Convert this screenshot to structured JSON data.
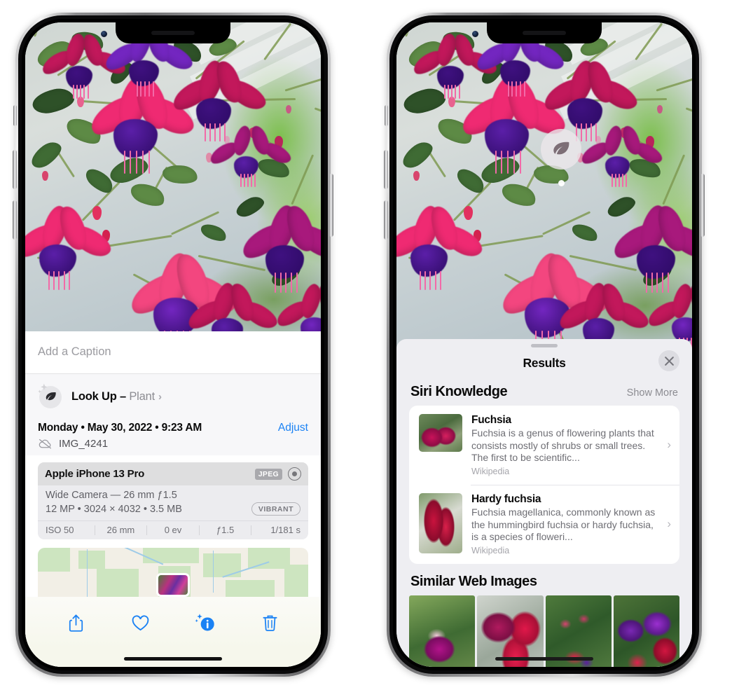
{
  "left_phone": {
    "caption": {
      "placeholder": "Add a Caption",
      "value": ""
    },
    "lookup": {
      "label": "Look Up – ",
      "subject": "Plant",
      "chevron": "›",
      "icon": "leaf-icon",
      "sparkle_icon": "sparkle-icon"
    },
    "info": {
      "date": "Monday • May 30, 2022 • 9:23 AM",
      "adjust_label": "Adjust",
      "filename": "IMG_4241",
      "cloud_icon": "cloud-slash-icon"
    },
    "camera_card": {
      "device": "Apple iPhone 13 Pro",
      "format_badge": "JPEG",
      "aperture_icon": "aperture-icon",
      "lens_line": "Wide Camera — 26 mm ƒ1.5",
      "specs_line": "12 MP • 3024 × 4032 • 3.5 MB",
      "style_badge": "VIBRANT",
      "exif": [
        "ISO 50",
        "26 mm",
        "0 ev",
        "ƒ1.5",
        "1/181 s"
      ]
    },
    "toolbar": [
      {
        "name": "share-button",
        "icon": "share-icon"
      },
      {
        "name": "favorite-button",
        "icon": "heart-icon"
      },
      {
        "name": "info-button",
        "icon": "info-sparkle-icon"
      },
      {
        "name": "delete-button",
        "icon": "trash-icon"
      }
    ],
    "map": {
      "pin_icon": "photo-pin"
    }
  },
  "right_phone": {
    "badge": {
      "icon": "leaf-icon"
    },
    "sheet": {
      "title": "Results",
      "close_label": "✕",
      "grabber": ""
    },
    "siri_knowledge": {
      "heading": "Siri Knowledge",
      "show_more": "Show More",
      "items": [
        {
          "title": "Fuchsia",
          "description": "Fuchsia is a genus of flowering plants that consists mostly of shrubs or small trees. The first to be scientific...",
          "source": "Wikipedia",
          "chevron": "›",
          "thumb": "fuchsia-red-thumb"
        },
        {
          "title": "Hardy fuchsia",
          "description": "Fuchsia magellanica, commonly known as the hummingbird fuchsia or hardy fuchsia, is a species of floweri...",
          "source": "Wikipedia",
          "chevron": "›",
          "thumb": "hardy-fuchsia-thumb"
        }
      ]
    },
    "similar_web_images": {
      "heading": "Similar Web Images",
      "items": [
        "web-image-1",
        "web-image-2",
        "web-image-3",
        "web-image-4"
      ]
    }
  },
  "colors": {
    "accent_blue": "#1b82f4",
    "sheet_gray": "#eeeef2",
    "card_gray": "#ececef",
    "text_secondary": "#6e6e74"
  }
}
